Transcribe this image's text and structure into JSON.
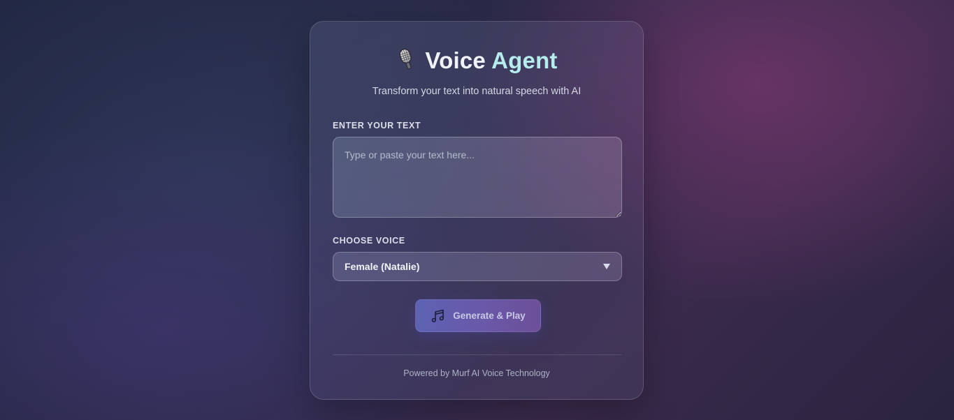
{
  "header": {
    "icon": "microphone-icon",
    "title_part1": "Voice",
    "title_part2": "Agent",
    "subtitle": "Transform your text into natural speech with AI"
  },
  "text_input": {
    "label": "ENTER YOUR TEXT",
    "value": "",
    "placeholder": "Type or paste your text here..."
  },
  "voice_select": {
    "label": "CHOOSE VOICE",
    "selected": "Female (Natalie)",
    "icon": "chevron-down-icon"
  },
  "action": {
    "icon": "music-note-icon",
    "label": "Generate & Play"
  },
  "footer": {
    "text": "Powered by Murf AI Voice Technology"
  },
  "colors": {
    "title_primary": "#f1f3fb",
    "title_accent": "#b5ecec",
    "button_start": "#5c62b4",
    "button_end": "#6c4f98"
  }
}
